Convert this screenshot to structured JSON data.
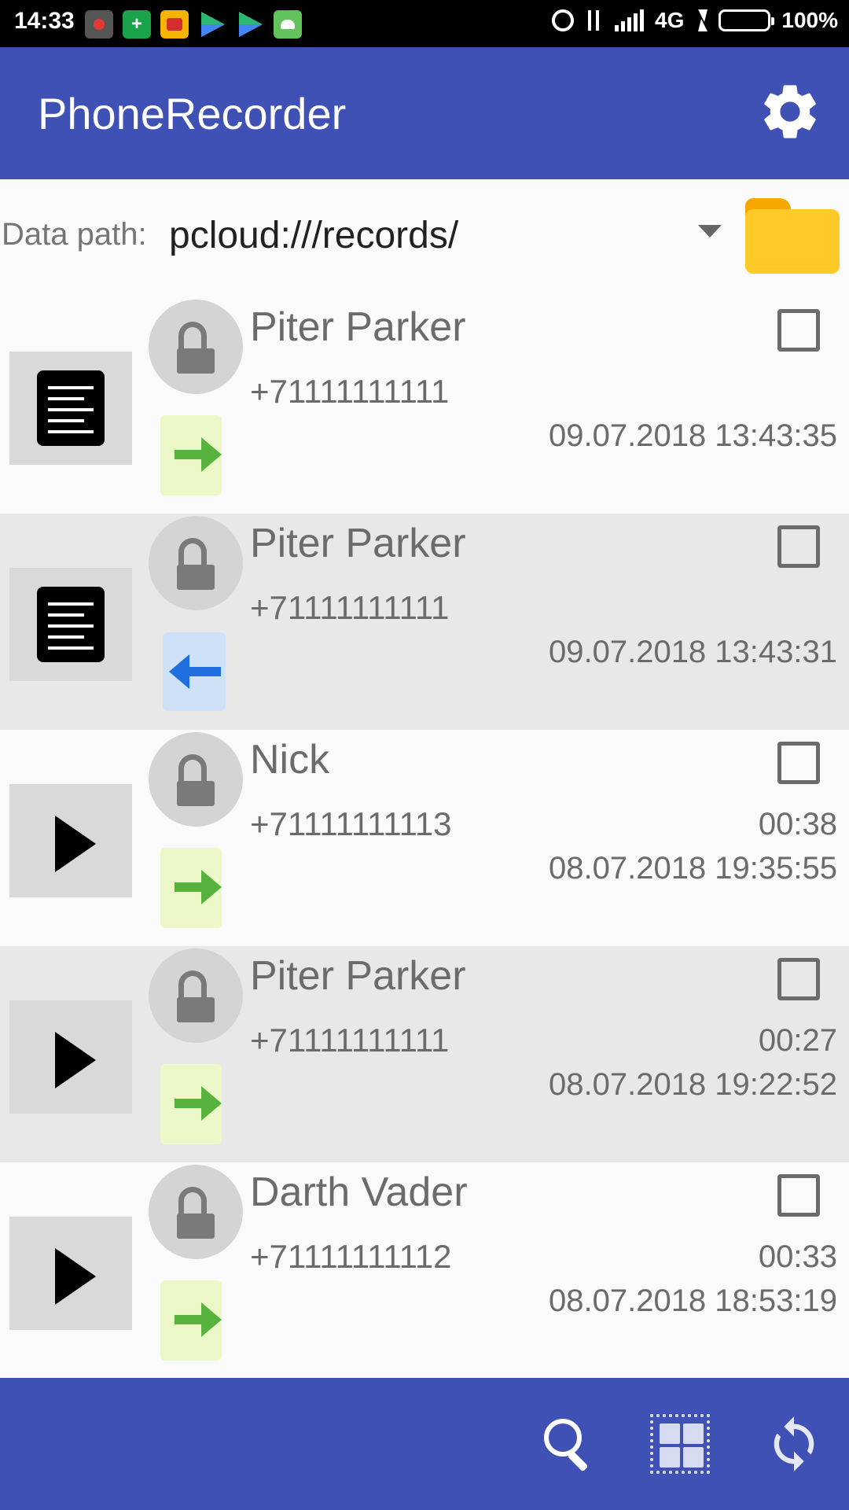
{
  "status_bar": {
    "time": "14:33",
    "network": "4G",
    "battery": "100%",
    "battery_level": 1.0,
    "notification_icons": [
      "screen-recorder-icon",
      "security-shield-icon",
      "tag-app-icon",
      "play-store-icon",
      "play-store-icon",
      "android-app-icon"
    ],
    "system_icons": [
      "alarm-icon",
      "data-transfer-icon",
      "signal-icon",
      "charging-icon",
      "battery-icon"
    ]
  },
  "app_bar": {
    "title": "PhoneRecorder",
    "settings_icon": "gear-icon",
    "background_color": "#3f51b5"
  },
  "data_path": {
    "label": "Data path:",
    "value": "pcloud:///records/",
    "folder_icon": "folder-icon"
  },
  "records": [
    {
      "name": "Piter Parker",
      "phone": "+71111111111",
      "duration": "",
      "datetime": "09.07.2018 13:43:35",
      "action_icon": "document-icon",
      "direction": "outgoing",
      "checked": false
    },
    {
      "name": "Piter Parker",
      "phone": "+71111111111",
      "duration": "",
      "datetime": "09.07.2018 13:43:31",
      "action_icon": "document-icon",
      "direction": "incoming",
      "checked": false
    },
    {
      "name": "Nick",
      "phone": "+71111111113",
      "duration": "00:38",
      "datetime": "08.07.2018 19:35:55",
      "action_icon": "play-icon",
      "direction": "outgoing",
      "checked": false
    },
    {
      "name": "Piter Parker",
      "phone": "+71111111111",
      "duration": "00:27",
      "datetime": "08.07.2018 19:22:52",
      "action_icon": "play-icon",
      "direction": "outgoing",
      "checked": false
    },
    {
      "name": "Darth Vader",
      "phone": "+71111111112",
      "duration": "00:33",
      "datetime": "08.07.2018 18:53:19",
      "action_icon": "play-icon",
      "direction": "outgoing",
      "checked": false
    }
  ],
  "bottom_bar": {
    "icons": [
      "search-icon",
      "select-all-icon",
      "refresh-icon"
    ]
  },
  "colors": {
    "primary": "#3f51b5",
    "folder": "#ffca28",
    "outgoing_arrow": "#57b33d",
    "incoming_arrow": "#1f6fe0",
    "battery": "#44d23b"
  }
}
